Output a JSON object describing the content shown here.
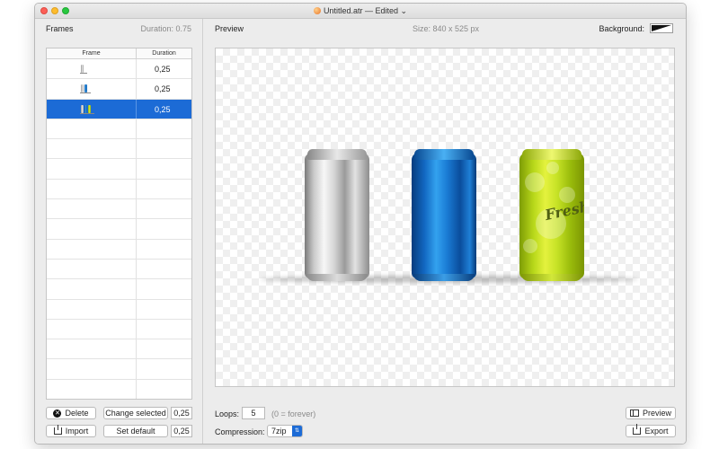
{
  "window": {
    "title": "Untitled.atr — Edited",
    "title_chevron": "⌄"
  },
  "frames_panel": {
    "title": "Frames",
    "duration": "Duration: 0.75",
    "columns": {
      "frame": "Frame",
      "duration": "Duration"
    },
    "rows": [
      {
        "duration": "0,25",
        "cans": [
          "silver"
        ],
        "selected": false
      },
      {
        "duration": "0,25",
        "cans": [
          "silver",
          "blue"
        ],
        "selected": false
      },
      {
        "duration": "0,25",
        "cans": [
          "silver",
          "blue",
          "green"
        ],
        "selected": true
      }
    ],
    "delete_label": "Delete",
    "import_label": "Import",
    "change_selected_label": "Change selected",
    "change_selected_value": "0,25",
    "set_default_label": "Set default",
    "set_default_value": "0,25"
  },
  "preview_panel": {
    "title": "Preview",
    "size": "Size: 840 x 525 px",
    "background_label": "Background:",
    "can_text": "Fresh",
    "loops_label": "Loops:",
    "loops_value": "5",
    "loops_hint": "(0 = forever)",
    "compression_label": "Compression:",
    "compression_value": "7zip",
    "preview_button": "Preview",
    "export_button": "Export"
  },
  "icons": {
    "delete": "x-circle-icon",
    "import": "import-icon",
    "export": "export-icon",
    "preview": "preview-icon"
  },
  "colors": {
    "selection": "#1c6bd6",
    "close": "#fc5f57",
    "minimize": "#fdbc2e",
    "maximize": "#28c840"
  }
}
